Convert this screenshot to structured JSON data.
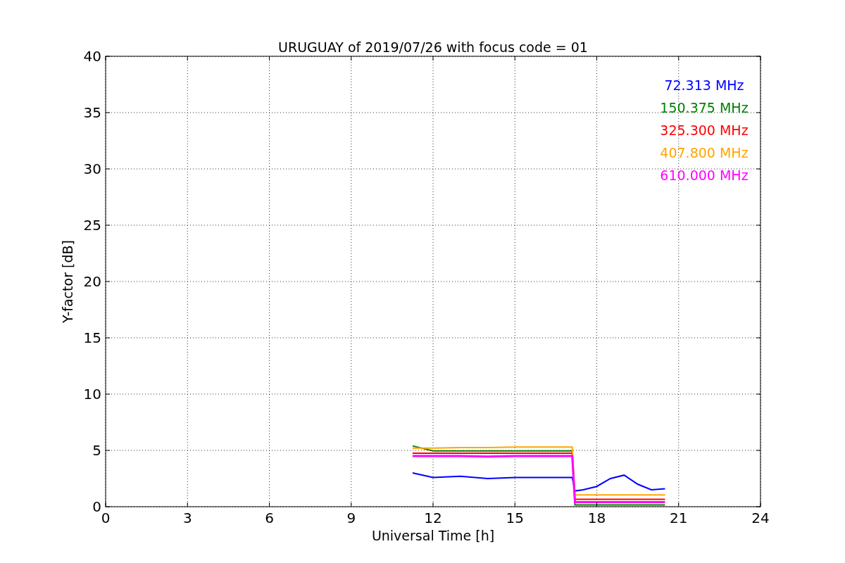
{
  "chart_data": {
    "type": "line",
    "title": "URUGUAY of 2019/07/26 with focus code = 01",
    "xlabel": "Universal Time [h]",
    "ylabel": "Y-factor [dB]",
    "xlim": [
      0,
      24
    ],
    "ylim": [
      0,
      40
    ],
    "xticks": [
      0,
      3,
      6,
      9,
      12,
      15,
      18,
      21,
      24
    ],
    "yticks": [
      0,
      5,
      10,
      15,
      20,
      25,
      30,
      35,
      40
    ],
    "grid": true,
    "x": [
      11.25,
      12,
      13,
      14,
      15,
      16,
      17,
      17.1,
      17.2,
      17.5,
      18,
      18.5,
      19,
      19.5,
      20,
      20.5
    ],
    "series": [
      {
        "name": "72.313 MHz",
        "color": "#0000ff",
        "values": [
          3.0,
          2.6,
          2.7,
          2.5,
          2.6,
          2.6,
          2.6,
          2.6,
          1.4,
          1.5,
          1.8,
          2.5,
          2.8,
          2.0,
          1.5,
          1.6
        ]
      },
      {
        "name": "150.375 MHz",
        "color": "#008000",
        "values": [
          5.4,
          4.95,
          4.95,
          4.95,
          4.95,
          4.95,
          4.95,
          4.95,
          0.15,
          0.15,
          0.15,
          0.15,
          0.15,
          0.15,
          0.15,
          0.15
        ]
      },
      {
        "name": "325.300 MHz",
        "color": "#ff0000",
        "values": [
          4.75,
          4.75,
          4.75,
          4.75,
          4.75,
          4.75,
          4.75,
          4.75,
          0.65,
          0.65,
          0.65,
          0.65,
          0.65,
          0.65,
          0.65,
          0.65
        ]
      },
      {
        "name": "407.800 MHz",
        "color": "#ffa500",
        "values": [
          5.2,
          5.2,
          5.25,
          5.25,
          5.3,
          5.3,
          5.3,
          5.3,
          1.05,
          1.05,
          1.05,
          1.05,
          1.05,
          1.05,
          1.05,
          1.05
        ]
      },
      {
        "name": "610.000 MHz",
        "color": "#ff00ff",
        "values": [
          4.5,
          4.5,
          4.5,
          4.45,
          4.5,
          4.5,
          4.5,
          4.5,
          0.4,
          0.4,
          0.4,
          0.4,
          0.4,
          0.4,
          0.4,
          0.4
        ]
      }
    ]
  }
}
